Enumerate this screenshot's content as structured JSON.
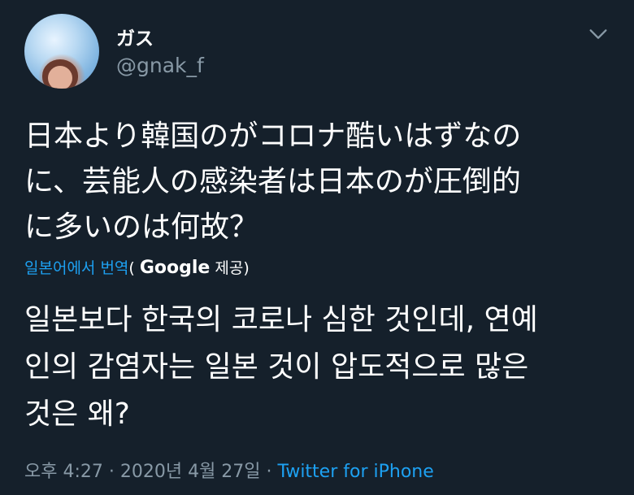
{
  "user": {
    "display_name": "ガス",
    "handle": "@gnak_f"
  },
  "tweet": {
    "text": "日本より韓国のがコロナ酷いはずなの\nに、芸能人の感染者は日本のが圧倒的\nに多いのは何故？"
  },
  "translation": {
    "link_label": "일본어에서 번역",
    "open_paren": "( ",
    "provider": "Google",
    "provided_label": " 제공)",
    "text": "일본보다 한국의 코로나 심한 것인데, 연예\n인의 감염자는 일본 것이 압도적으로 많은\n것은 왜?"
  },
  "meta": {
    "timestamp": "오후 4:27 · 2020년 4월 27일 · ",
    "source": "Twitter for iPhone"
  },
  "icons": {
    "caret": "chevron-down-icon",
    "avatar": "user-avatar"
  },
  "colors": {
    "background": "#15202b",
    "link": "#1da1f2",
    "secondary": "#8899a6"
  }
}
